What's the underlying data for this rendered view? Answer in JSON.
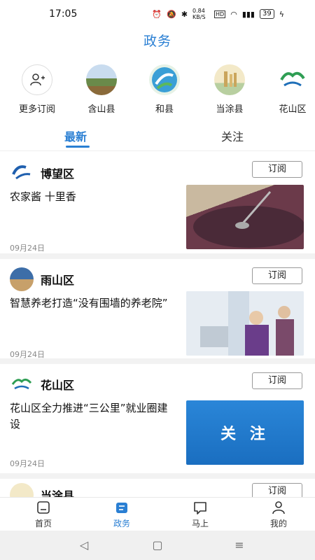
{
  "status": {
    "time": "17:05",
    "net_speed": "0.84 KB/S",
    "battery": "39"
  },
  "header": {
    "title": "政务"
  },
  "subscriptions": [
    {
      "label": "更多订阅",
      "icon": "add-user-icon"
    },
    {
      "label": "含山县"
    },
    {
      "label": "和县"
    },
    {
      "label": "当涂县"
    },
    {
      "label": "花山区"
    }
  ],
  "tabs": [
    {
      "label": "最新"
    },
    {
      "label": "关注"
    }
  ],
  "feed": [
    {
      "org": "博望区",
      "subscribe_label": "订阅",
      "title": "农家酱  十里香",
      "date": "09月24日"
    },
    {
      "org": "雨山区",
      "subscribe_label": "订阅",
      "title": "智慧养老打造“没有围墙的养老院”",
      "date": "09月24日"
    },
    {
      "org": "花山区",
      "subscribe_label": "订阅",
      "title": "花山区全力推进“三公里”就业圈建设",
      "date": "09月24日",
      "image_text": "关 注"
    },
    {
      "org": "当涂县",
      "subscribe_label": "订阅"
    }
  ],
  "bottom_nav": [
    {
      "label": "首页",
      "icon": "home-icon"
    },
    {
      "label": "政务",
      "icon": "government-icon"
    },
    {
      "label": "马上",
      "icon": "chat-icon"
    },
    {
      "label": "我的",
      "icon": "user-icon"
    }
  ],
  "colors": {
    "accent": "#2a7fd3"
  }
}
